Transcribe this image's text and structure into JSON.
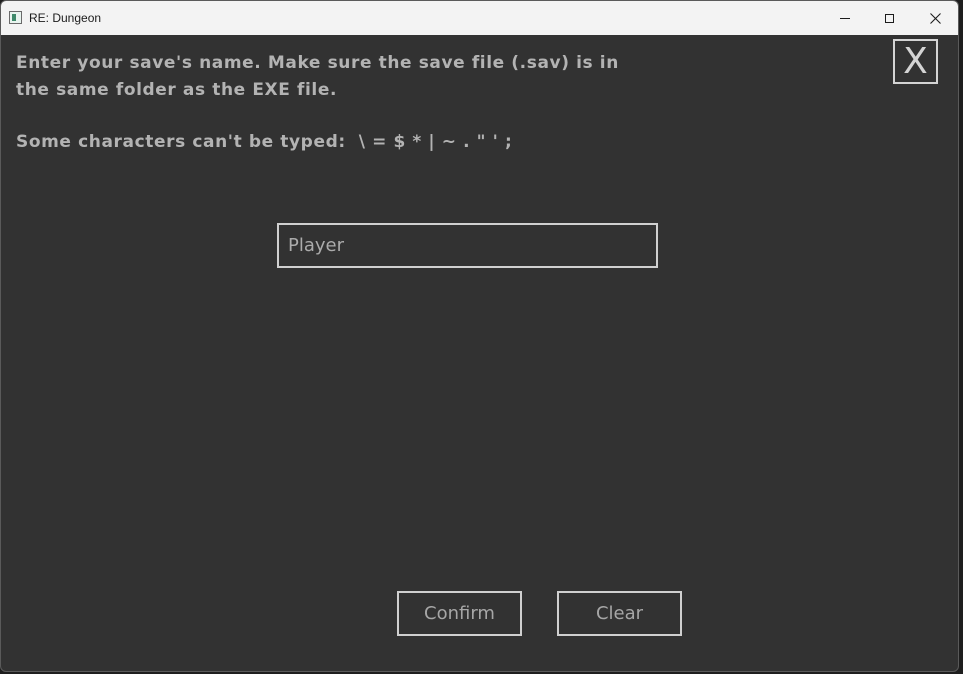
{
  "window": {
    "title": "RE: Dungeon",
    "controls": {
      "minimize": "minimize-icon",
      "maximize": "maximize-icon",
      "close": "close-icon"
    }
  },
  "dialog": {
    "instruction_lines": [
      "Enter your save's name. Make sure the save file (.sav) is in",
      "the same folder as the EXE file."
    ],
    "restricted_chars_text": "Some characters can't be typed:  \\ = $ * | ~ . \" ' ;",
    "close_label": "X",
    "name_input": {
      "value": "Player"
    },
    "confirm_label": "Confirm",
    "clear_label": "Clear"
  },
  "colors": {
    "background": "#323232",
    "text": "#b3b3b3",
    "border": "#d0d0d0",
    "titlebar": "#f3f3f3"
  }
}
